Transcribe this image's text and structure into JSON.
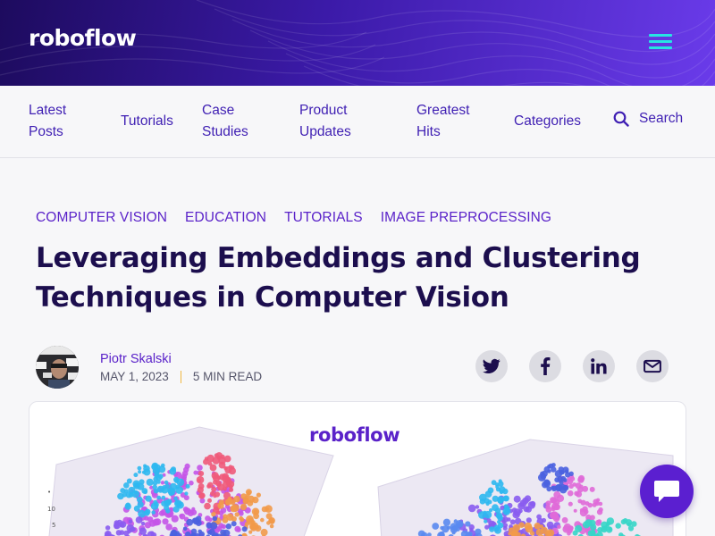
{
  "header": {
    "logo_text": "roboflow"
  },
  "nav": {
    "items": [
      {
        "line1": "Latest",
        "line2": "Posts"
      },
      {
        "line1": "Tutorials",
        "line2": ""
      },
      {
        "line1": "Case",
        "line2": "Studies"
      },
      {
        "line1": "Product",
        "line2": "Updates"
      },
      {
        "line1": "Greatest",
        "line2": "Hits"
      },
      {
        "line1": "Categories",
        "line2": ""
      }
    ],
    "search_label": "Search"
  },
  "article": {
    "tags": [
      "COMPUTER VISION",
      "EDUCATION",
      "TUTORIALS",
      "IMAGE PREPROCESSING"
    ],
    "title": "Leveraging Embeddings and Clustering Techniques in Computer Vision",
    "author": "Piotr Skalski",
    "date": "MAY 1, 2023",
    "read_time": "5 MIN READ",
    "hero_logo_text": "roboflow"
  },
  "share_icons": [
    "twitter-icon",
    "facebook-icon",
    "linkedin-icon",
    "email-icon"
  ],
  "chat_icon": "chat-bubble-icon",
  "colors": {
    "accent": "#5a22c9",
    "title": "#1c0e4e",
    "hamburger": "#27e3e3",
    "header_start": "#1d0b5e",
    "header_end": "#6a3bea"
  }
}
